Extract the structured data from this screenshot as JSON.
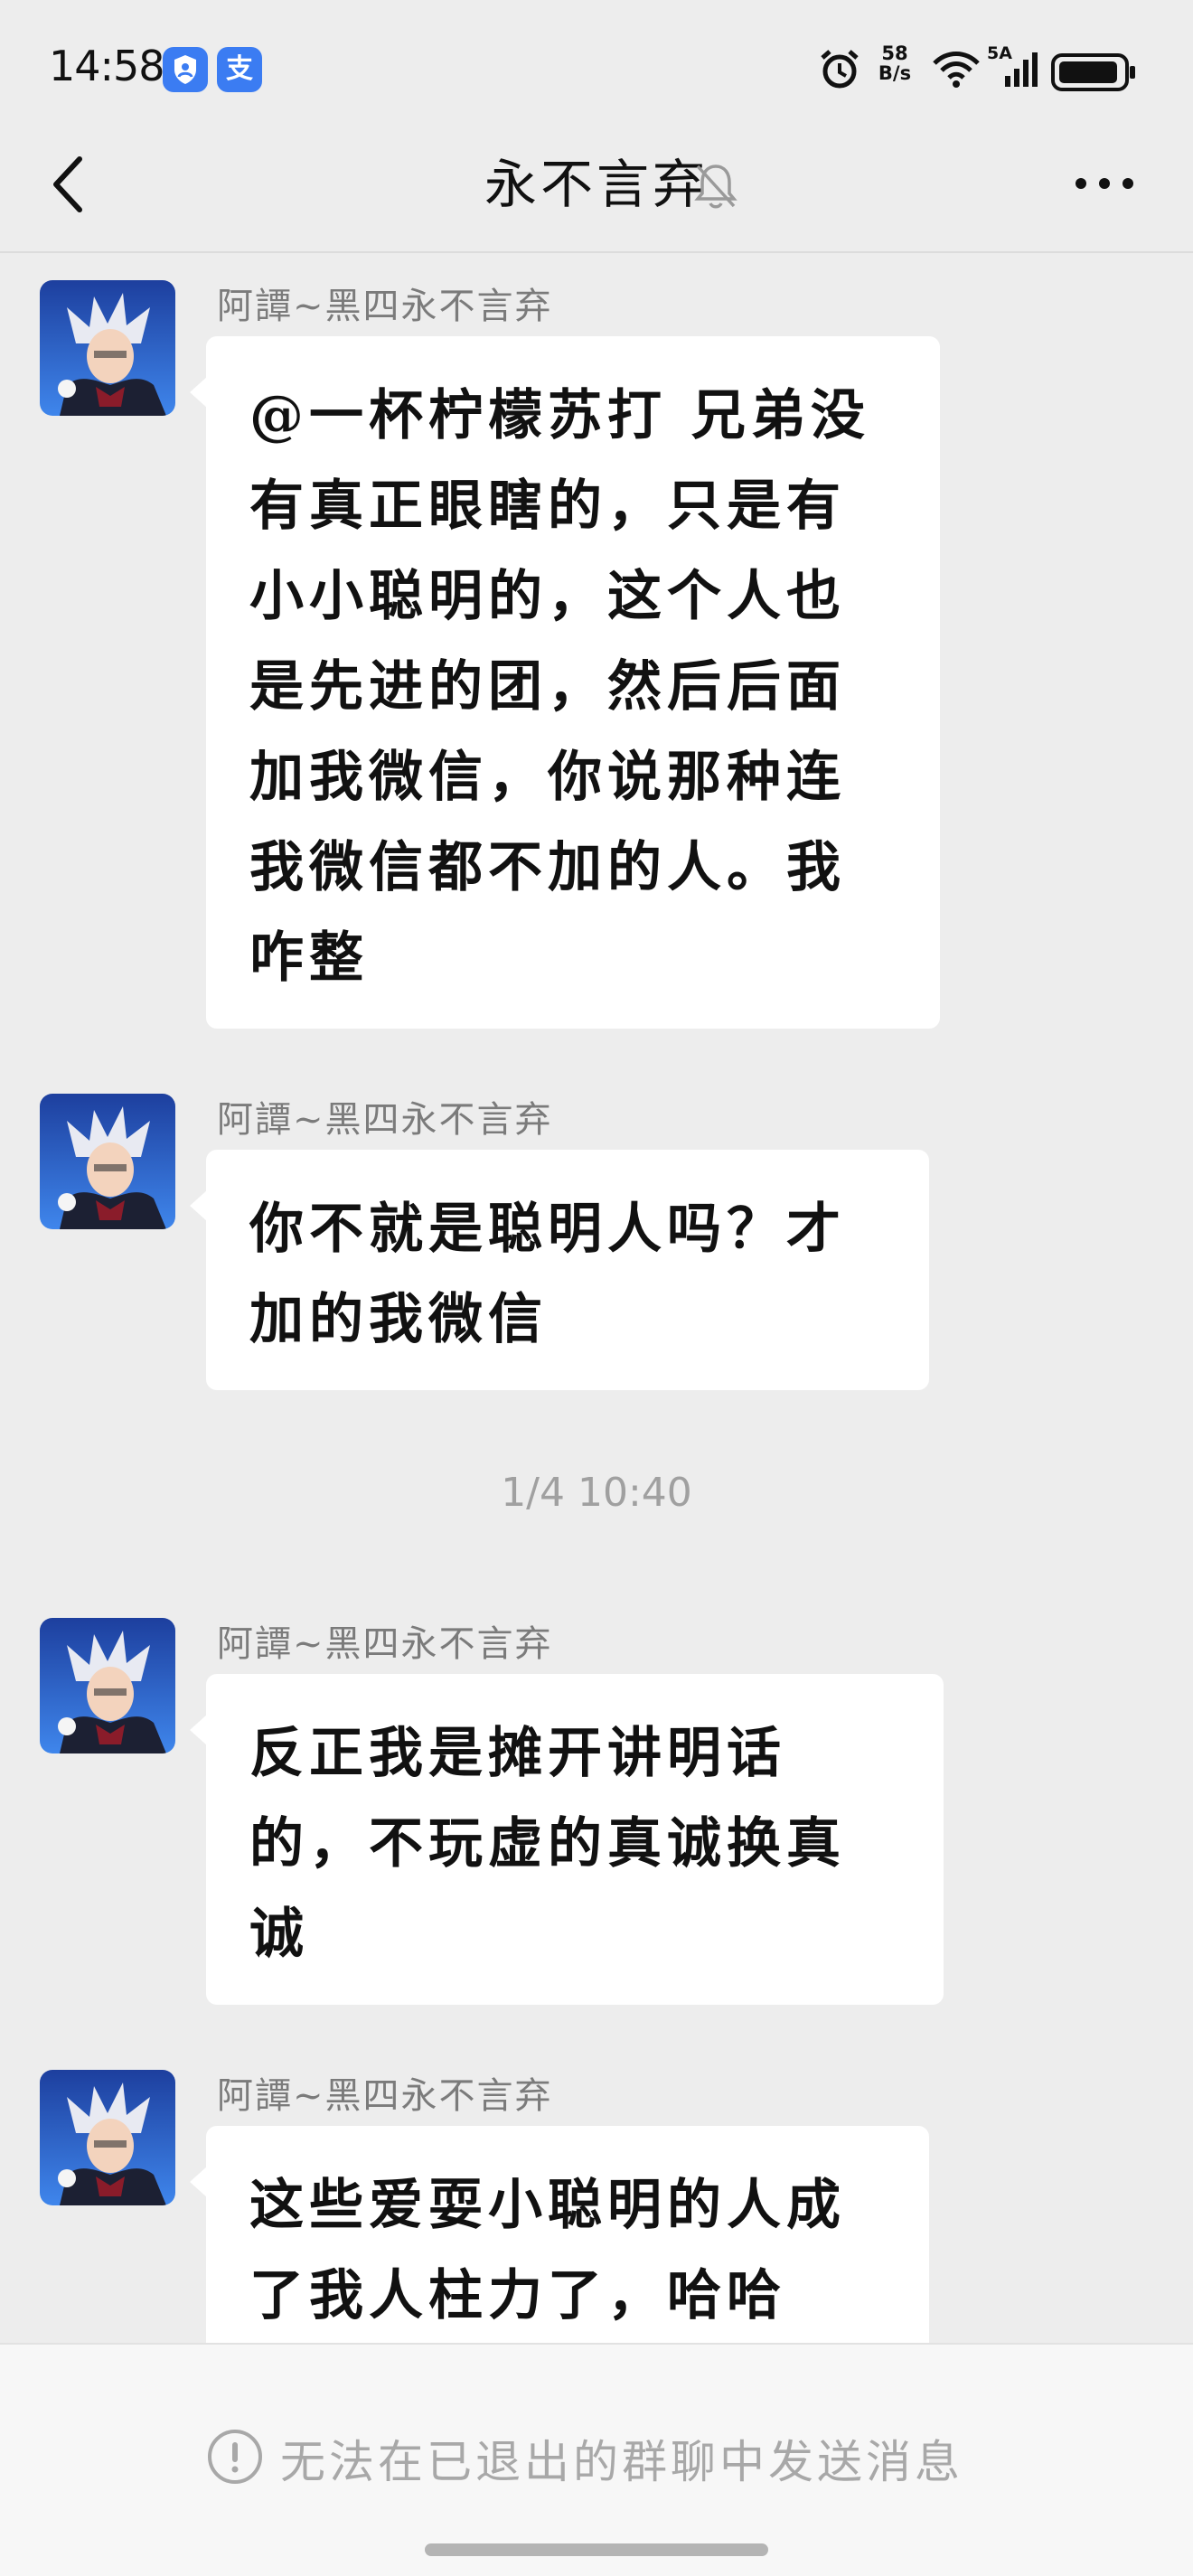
{
  "status_bar": {
    "time": "14:58",
    "app_icon_1": "shield-app-icon",
    "app_icon_2_glyph": "支",
    "net_speed_value": "58",
    "net_speed_unit": "B/s",
    "signal_label": "5A"
  },
  "header": {
    "title": "永不言弃",
    "muted": true
  },
  "messages": [
    {
      "sender": "阿譚~黑四永不言弃",
      "text": "@一杯柠檬苏打 兄弟没有真正眼瞎的，只是有小小聪明的，这个人也是先进的团，然后后面加我微信，你说那种连我微信都不加的人。我咋整"
    },
    {
      "sender": "阿譚~黑四永不言弃",
      "text": "你不就是聪明人吗？才加的我微信"
    },
    {
      "sender": "阿譚~黑四永不言弃",
      "text": "反正我是摊开讲明话的，不玩虚的真诚换真诚"
    },
    {
      "sender": "阿譚~黑四永不言弃",
      "text": "这些爱耍小聪明的人成了我人柱力了，哈哈"
    }
  ],
  "timestamp": "1/4 10:40",
  "footer": {
    "notice": "无法在已退出的群聊中发送消息"
  },
  "colors": {
    "background": "#ededed",
    "bubble": "#ffffff",
    "accent_blue": "#3b7cf2",
    "muted_text": "#7b7b7b"
  }
}
